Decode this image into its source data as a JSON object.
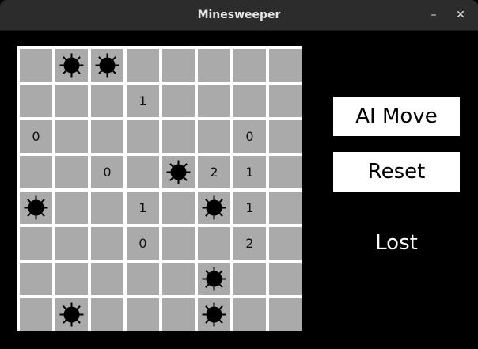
{
  "window": {
    "title": "Minesweeper",
    "minimize_glyph": "–",
    "close_glyph": "✕"
  },
  "controls": {
    "ai_move_label": "AI Move",
    "reset_label": "Reset"
  },
  "status_text": "Lost",
  "colors": {
    "cell": "#aaaaaa",
    "grid": "#ffffff",
    "background": "#000000",
    "mine": "#000000"
  },
  "board": [
    [
      "",
      "mine",
      "mine",
      "",
      "",
      "",
      "",
      ""
    ],
    [
      "",
      "",
      "",
      "1",
      "",
      "",
      "",
      ""
    ],
    [
      "0",
      "",
      "",
      "",
      "",
      "",
      "0",
      ""
    ],
    [
      "",
      "",
      "0",
      "",
      "mine",
      "2",
      "1",
      ""
    ],
    [
      "mine",
      "",
      "",
      "1",
      "",
      "mine",
      "1",
      ""
    ],
    [
      "",
      "",
      "",
      "0",
      "",
      "",
      "2",
      ""
    ],
    [
      "",
      "",
      "",
      "",
      "",
      "mine",
      "",
      ""
    ],
    [
      "",
      "mine",
      "",
      "",
      "",
      "mine",
      "",
      ""
    ]
  ]
}
